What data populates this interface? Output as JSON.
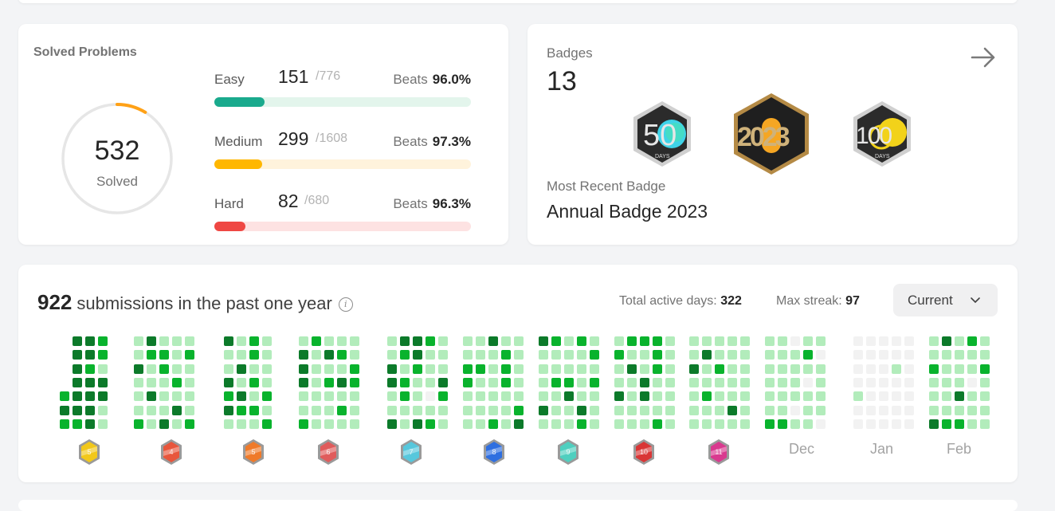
{
  "solved": {
    "title": "Solved Problems",
    "total": "532",
    "total_label": "Solved",
    "progress_fraction": 0.0869,
    "difficulties": [
      {
        "name": "Easy",
        "count": "151",
        "total": "/776",
        "beats_label": "Beats",
        "beats": "96.0%",
        "fill_fraction": 0.195,
        "color": "#1aaa8d",
        "track_color": "#e3f5ec"
      },
      {
        "name": "Medium",
        "count": "299",
        "total": "/1608",
        "beats_label": "Beats",
        "beats": "97.3%",
        "fill_fraction": 0.186,
        "color": "#ffb700",
        "track_color": "#fff3dc"
      },
      {
        "name": "Hard",
        "count": "82",
        "total": "/680",
        "beats_label": "Beats",
        "beats": "96.3%",
        "fill_fraction": 0.121,
        "color": "#ef4743",
        "track_color": "#fde2e2"
      }
    ]
  },
  "badges": {
    "title": "Badges",
    "count": "13",
    "items": [
      {
        "name": "50 Days Badge",
        "text": "50",
        "sub": "DAYS",
        "accent": "#3fd3e8"
      },
      {
        "name": "Annual Badge 2023",
        "text": "2023",
        "sub": "",
        "accent": "#f5a623"
      },
      {
        "name": "100 Days Badge",
        "text": "100",
        "sub": "DAYS",
        "accent": "#f2d21a"
      }
    ],
    "recent_label": "Most Recent Badge",
    "recent_name": "Annual Badge 2023",
    "arrow_icon": "arrow-right-icon"
  },
  "submissions": {
    "count": "922",
    "text": "submissions in the past one year",
    "active_days_label": "Total active days:",
    "active_days": "322",
    "max_streak_label": "Max streak:",
    "max_streak": "97",
    "range_selected": "Current",
    "month_labels": [
      "Dec",
      "Jan",
      "Feb"
    ],
    "monthly_badge_colors": [
      "#f2c81a",
      "#e8563c",
      "#ef7a2a",
      "#e05c5c",
      "#57c7dc",
      "#2f6fe0",
      "#4fcfbf",
      "#d93636",
      "#d93a8f"
    ],
    "monthly_badge_numbers": [
      "5",
      "4",
      "5",
      "6",
      "7",
      "8",
      "9",
      "10",
      "11"
    ],
    "level_colors": [
      "#f2f2f2",
      "#b2ecbb",
      "#09b32d",
      "#0c7a2a"
    ]
  }
}
